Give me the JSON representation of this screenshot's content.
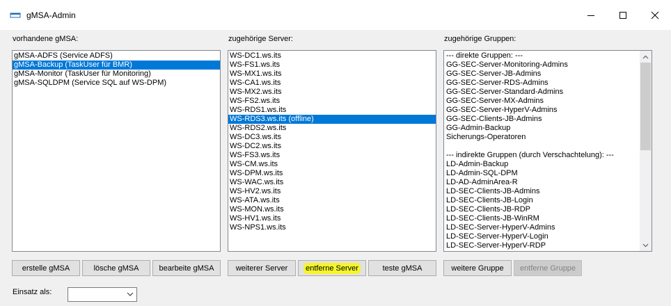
{
  "window": {
    "title": "gMSA-Admin"
  },
  "gmsa_panel": {
    "label": "vorhandene gMSA:",
    "items": [
      "gMSA-ADFS (Service ADFS)",
      "gMSA-Backup (TaskUser für BMR)",
      "gMSA-Monitor (TaskUser für Monitoring)",
      "gMSA-SQLDPM (Service SQL auf WS-DPM)"
    ],
    "selected_index": 1,
    "buttons": {
      "create": "erstelle gMSA",
      "delete": "lösche gMSA",
      "edit": "bearbeite gMSA"
    }
  },
  "server_panel": {
    "label": "zugehörige Server:",
    "items": [
      "WS-DC1.ws.its",
      "WS-FS1.ws.its",
      "WS-MX1.ws.its",
      "WS-CA1.ws.its",
      "WS-MX2.ws.its",
      "WS-FS2.ws.its",
      "WS-RDS1.ws.its",
      "WS-RDS3.ws.its (offline)",
      "WS-RDS2.ws.its",
      "WS-DC3.ws.its",
      "WS-DC2.ws.its",
      "WS-FS3.ws.its",
      "WS-CM.ws.its",
      "WS-DPM.ws.its",
      "WS-WAC.ws.its",
      "WS-HV2.ws.its",
      "WS-ATA.ws.its",
      "WS-MON.ws.its",
      "WS-HV1.ws.its",
      "WS-NPS1.ws.its"
    ],
    "selected_index": 7,
    "buttons": {
      "add": "weiterer Server",
      "remove": "entferne Server",
      "test": "teste gMSA"
    }
  },
  "group_panel": {
    "label": "zugehörige Gruppen:",
    "items": [
      "--- direkte Gruppen: ---",
      "GG-SEC-Server-Monitoring-Admins",
      "GG-SEC-Server-JB-Admins",
      "GG-SEC-Server-RDS-Admins",
      "GG-SEC-Server-Standard-Admins",
      "GG-SEC-Server-MX-Admins",
      "GG-SEC-Server-HyperV-Admins",
      "GG-SEC-Clients-JB-Admins",
      "GG-Admin-Backup",
      "Sicherungs-Operatoren",
      "",
      "--- indirekte Gruppen (durch Verschachtelung): ---",
      "LD-Admin-Backup",
      "LD-Admin-SQL-DPM",
      "LD-AD-AdminArea-R",
      "LD-SEC-Clients-JB-Admins",
      "LD-SEC-Clients-JB-Login",
      "LD-SEC-Clients-JB-RDP",
      "LD-SEC-Clients-JB-WinRM",
      "LD-SEC-Server-HyperV-Admins",
      "LD-SEC-Server-HyperV-Login",
      "LD-SEC-Server-HyperV-RDP"
    ],
    "buttons": {
      "add": "weitere Gruppe",
      "remove": "entferne Gruppe"
    }
  },
  "deploy": {
    "label": "Einsatz als:",
    "value": ""
  },
  "colors": {
    "selection": "#0078d7",
    "highlight": "#f5f52a"
  }
}
